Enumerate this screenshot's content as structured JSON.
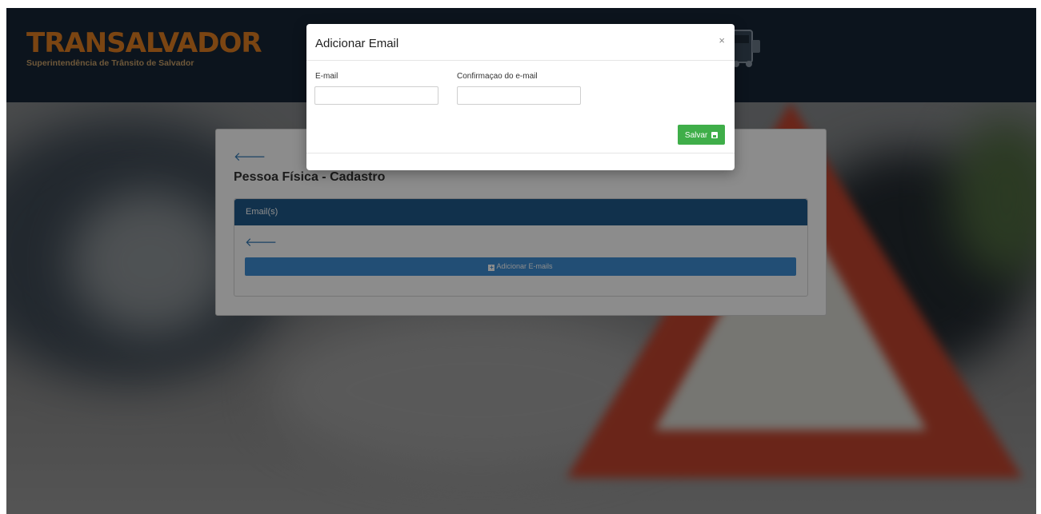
{
  "header": {
    "logo_title": "TRANSALVADOR",
    "logo_subtitle": "Superintendência de Trânsito de Salvador"
  },
  "main": {
    "back_symbol": "🡐",
    "page_title": "Pessoa Física - Cadastro",
    "panel_title": "Email(s)",
    "add_button_label": "Adicionar E-mails"
  },
  "modal": {
    "title": "Adicionar Email",
    "close_symbol": "×",
    "email_label": "E-mail",
    "email_value": "",
    "confirm_label": "Confirmaçao do e-mail",
    "confirm_value": "",
    "save_label": "Salvar"
  },
  "colors": {
    "header_bg": "#162535",
    "logo_orange": "#e07e22",
    "panel_header": "#1f5a8a",
    "add_button": "#3e8fd6",
    "save_button": "#3fae49",
    "back_arrow": "#337ab7"
  },
  "icons": [
    "arrow-left-icon",
    "plus-square-icon",
    "save-icon",
    "close-icon",
    "truck-logo-icon"
  ]
}
